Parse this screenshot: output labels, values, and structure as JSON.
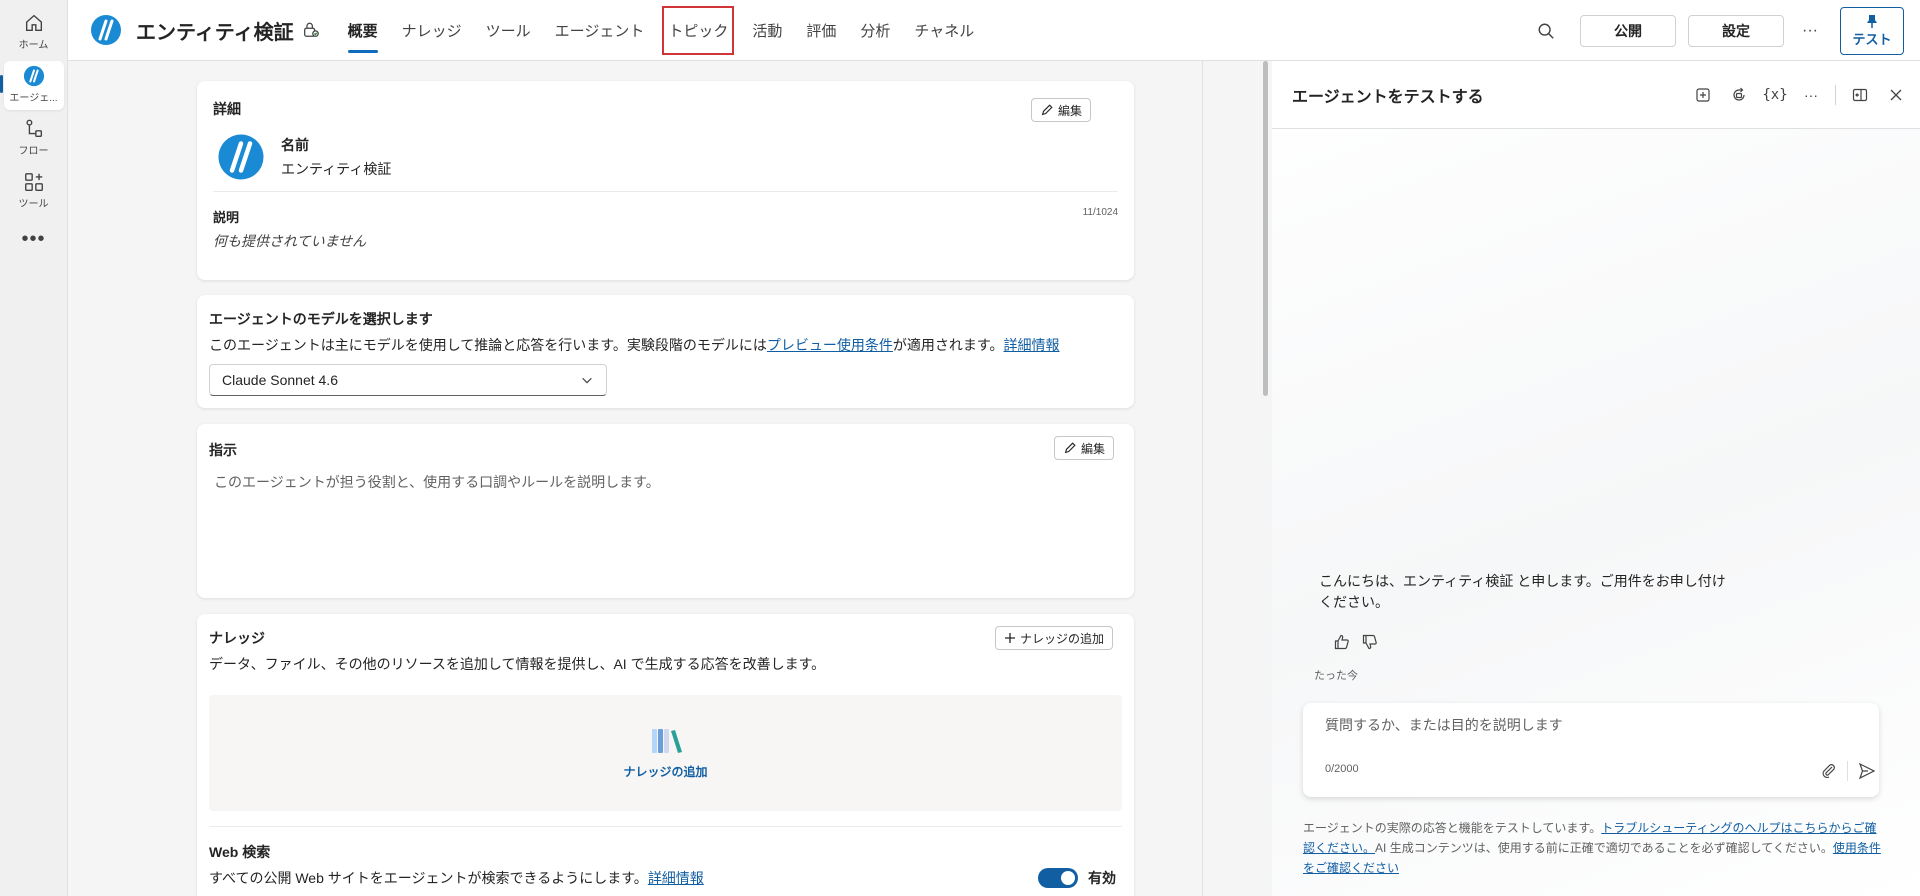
{
  "rail": {
    "items": [
      {
        "label": "ホーム",
        "icon": "home-icon"
      },
      {
        "label": "エージェ...",
        "icon": "agent-icon"
      },
      {
        "label": "フロー",
        "icon": "flow-icon"
      },
      {
        "label": "ツール",
        "icon": "tools-icon"
      }
    ],
    "more": "•••"
  },
  "header": {
    "title": "エンティティ検証",
    "tabs": [
      {
        "label": "概要"
      },
      {
        "label": "ナレッジ"
      },
      {
        "label": "ツール"
      },
      {
        "label": "エージェント"
      },
      {
        "label": "トピック"
      },
      {
        "label": "活動"
      },
      {
        "label": "評価"
      },
      {
        "label": "分析"
      },
      {
        "label": "チャネル"
      }
    ],
    "publish_label": "公開",
    "settings_label": "設定",
    "more_label": "···",
    "test_label": "テスト"
  },
  "details": {
    "heading": "詳細",
    "edit_label": "編集",
    "name_label": "名前",
    "name_value": "エンティティ検証",
    "desc_label": "説明",
    "desc_count": "11/1024",
    "desc_value": "何も提供されていません"
  },
  "model": {
    "heading": "エージェントのモデルを選択します",
    "text_before": "このエージェントは主にモデルを使用して推論と応答を行います。実験段階のモデルには",
    "link1": "プレビュー使用条件",
    "text_after": "が適用されます。",
    "link2": "詳細情報",
    "selected": "Claude Sonnet 4.6"
  },
  "instructions": {
    "heading": "指示",
    "edit_label": "編集",
    "placeholder": "このエージェントが担う役割と、使用する口調やルールを説明します。"
  },
  "knowledge": {
    "heading": "ナレッジ",
    "add_button": "ナレッジの追加",
    "description": "データ、ファイル、その他のリソースを追加して情報を提供し、AI で生成する応答を改善します。",
    "add_tile": "ナレッジの追加",
    "web_heading": "Web 検索",
    "web_text": "すべての公開 Web サイトをエージェントが検索できるようにします。",
    "web_link": "詳細情報",
    "web_toggle_label": "有効"
  },
  "test_panel": {
    "title": "エージェントをテストする",
    "message": "こんにちは、エンティティ検証 と申します。ご用件をお申し付けください。",
    "timestamp": "たった今",
    "input_placeholder": "質問するか、または目的を説明します",
    "char_count": "0/2000",
    "disclaimer_before": "エージェントの実際の応答と機能をテストしています。",
    "disclaimer_link1": "トラブルシューティングのヘルプはこちらからご確認ください。",
    "disclaimer_middle": "AI 生成コンテンツは、使用する前に正確で適切であることを必ず確認してください。",
    "disclaimer_link2": "使用条件をご確認ください"
  },
  "colors": {
    "accent": "#115ea3",
    "highlight": "#d13438"
  }
}
